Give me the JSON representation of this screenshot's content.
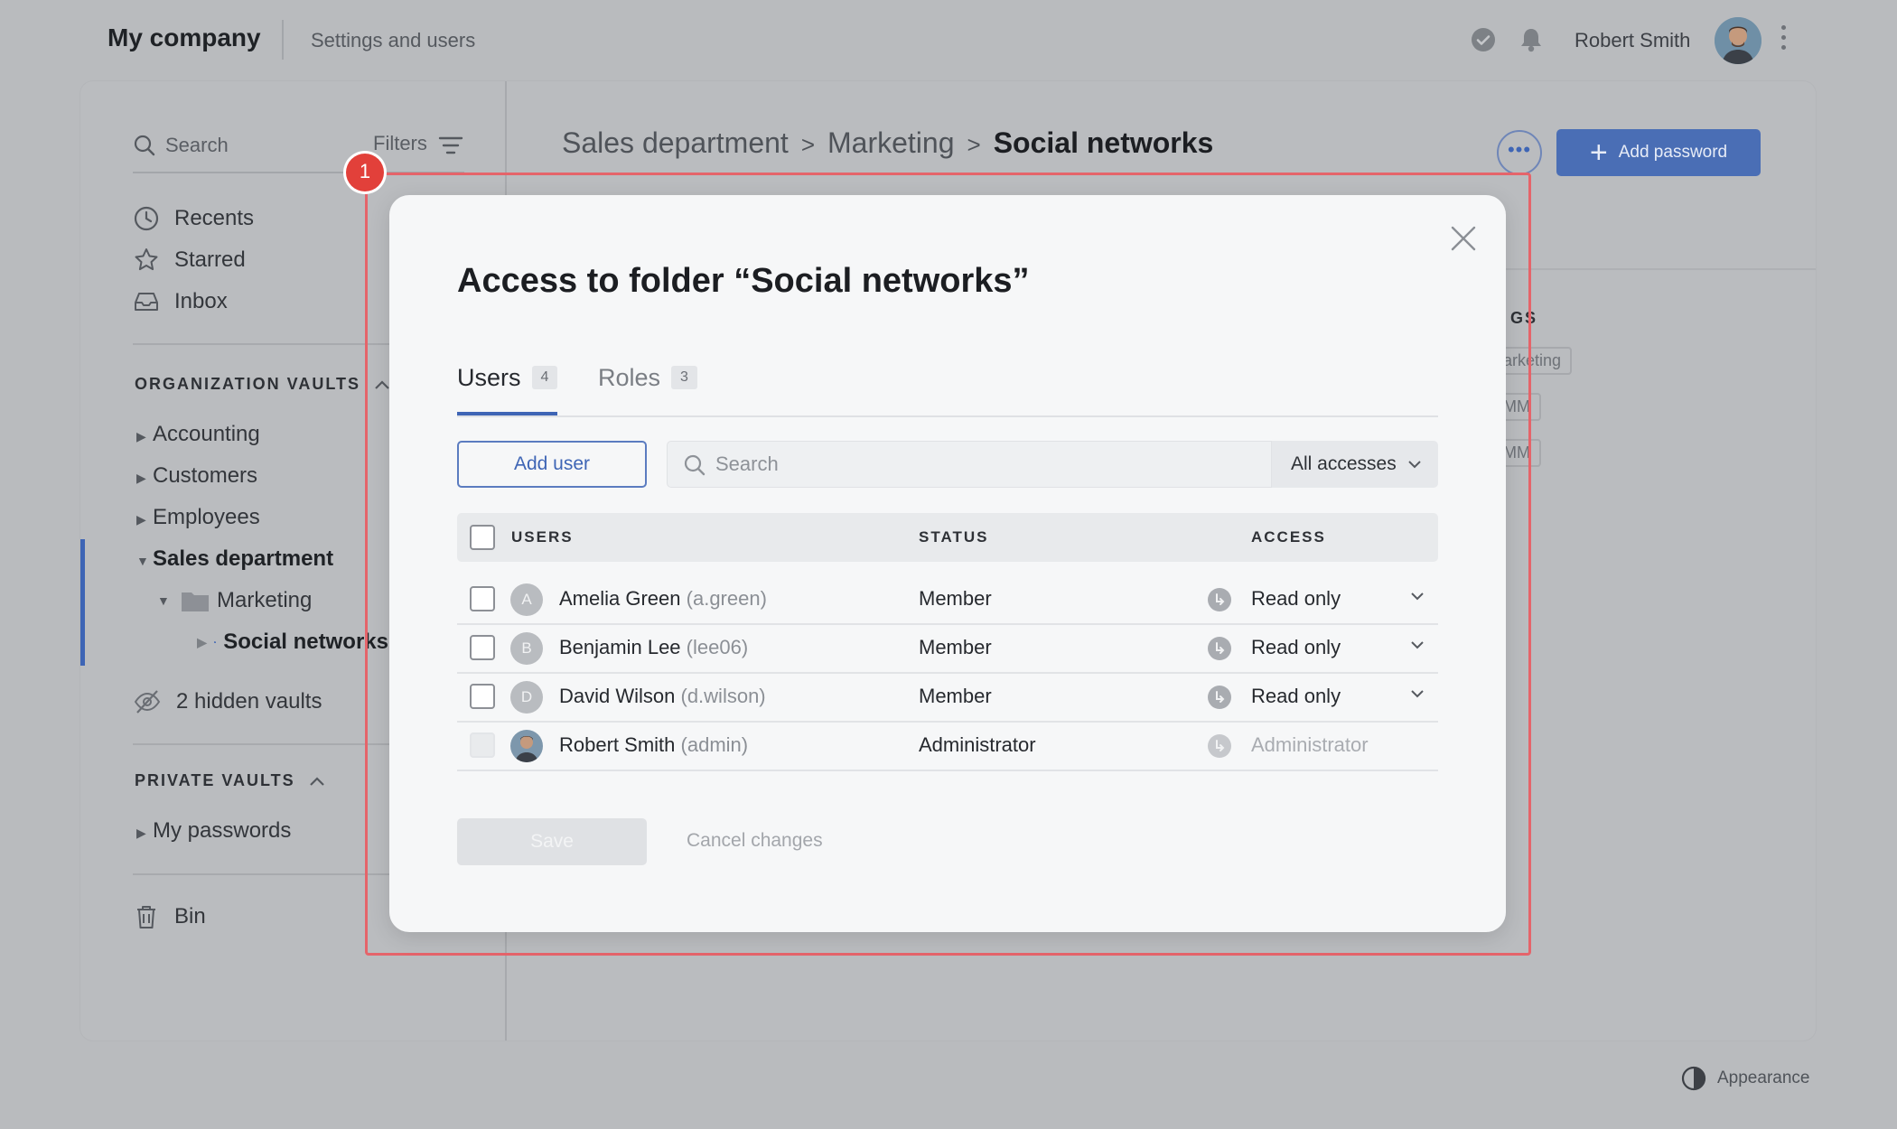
{
  "topbar": {
    "brand": "My company",
    "subtitle": "Settings and users",
    "username": "Robert Smith"
  },
  "sidebar": {
    "search_label": "Search",
    "filters_label": "Filters",
    "nav": [
      {
        "label": "Recents",
        "icon": "clock-icon"
      },
      {
        "label": "Starred",
        "icon": "star-icon"
      },
      {
        "label": "Inbox",
        "icon": "inbox-icon"
      }
    ],
    "org_title": "ORGANIZATION VAULTS",
    "org_vaults": [
      "Accounting",
      "Customers",
      "Employees"
    ],
    "sales": "Sales department",
    "marketing": "Marketing",
    "social": "Social networks",
    "hidden": "2 hidden vaults",
    "private_title": "PRIVATE VAULTS",
    "my_passwords": "My passwords",
    "bin": "Bin"
  },
  "breadcrumb": {
    "part1": "Sales department",
    "part2": "Marketing",
    "current": "Social networks"
  },
  "header": {
    "add_password": "Add password"
  },
  "background": {
    "tags_heading": "GS",
    "tags": [
      "arketing",
      "MM",
      "MM"
    ]
  },
  "highlight": {
    "badge": "1"
  },
  "modal": {
    "title": "Access to folder “Social networks”",
    "tabs": [
      {
        "label": "Users",
        "count": "4"
      },
      {
        "label": "Roles",
        "count": "3"
      }
    ],
    "add_user": "Add user",
    "search_placeholder": "Search",
    "filter_value": "All accesses",
    "columns": {
      "users": "USERS",
      "status": "STATUS",
      "access": "ACCESS"
    },
    "rows": [
      {
        "initial": "A",
        "name": "Amelia Green",
        "login": "(a.green)",
        "status": "Member",
        "access": "Read only"
      },
      {
        "initial": "B",
        "name": "Benjamin Lee",
        "login": "(lee06)",
        "status": "Member",
        "access": "Read only"
      },
      {
        "initial": "D",
        "name": "David Wilson",
        "login": "(d.wilson)",
        "status": "Member",
        "access": "Read only"
      },
      {
        "initial": "",
        "name": "Robert Smith",
        "login": "(admin)",
        "status": "Administrator",
        "access": "Administrator"
      }
    ],
    "save": "Save",
    "cancel": "Cancel changes"
  },
  "footer": {
    "appearance": "Appearance"
  },
  "colors": {
    "accent": "#3e65b5",
    "highlight": "#e5646a",
    "badge": "#e2403a"
  }
}
